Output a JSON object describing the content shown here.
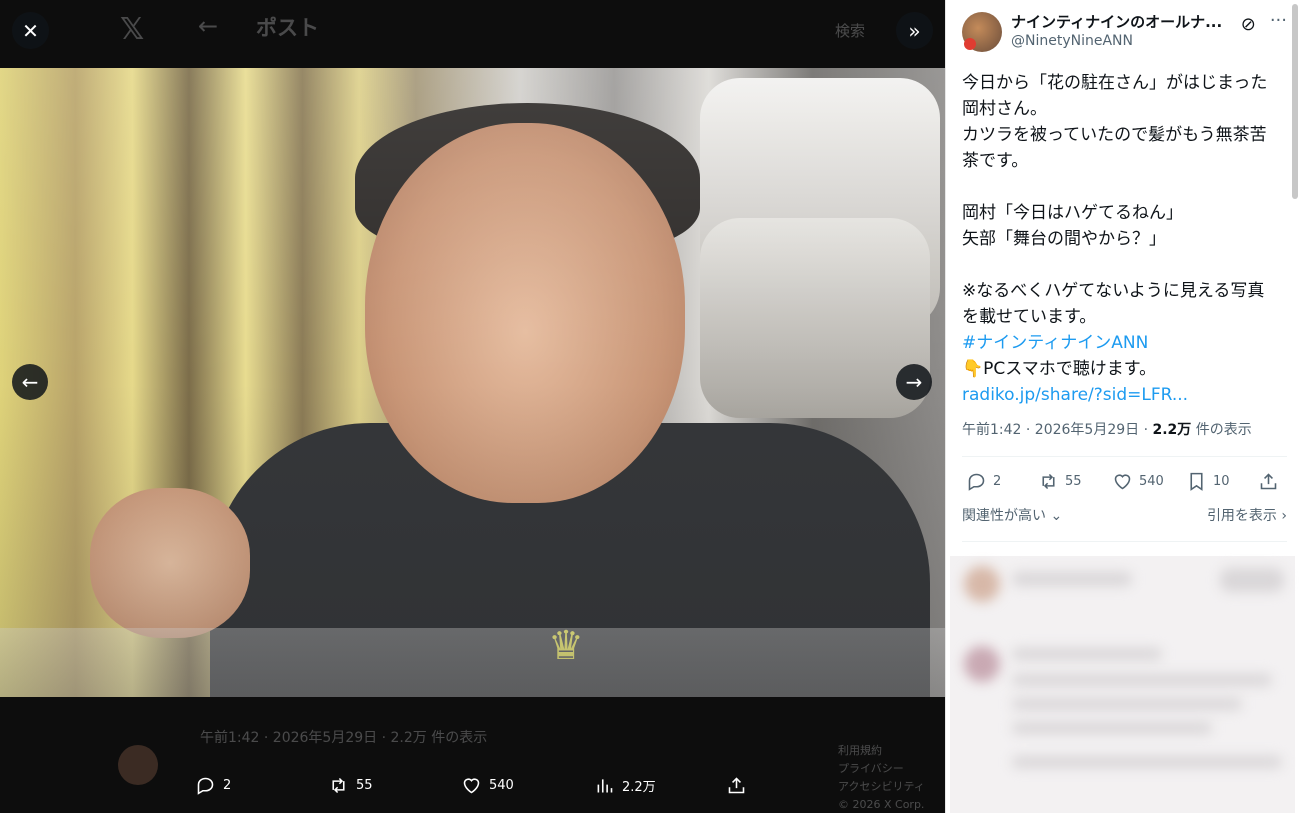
{
  "viewer": {
    "bg_title": "ポスト",
    "bg_search": "検索",
    "bg_meta": "午前1:42 · 2026年5月29日 · 2.2万 件の表示",
    "bg_side": [
      "利用規約",
      "プライバシー",
      "アクセシビリティ",
      "© 2026 X Corp."
    ],
    "actions": {
      "replies": "2",
      "reposts": "55",
      "likes": "540",
      "views": "2.2万"
    }
  },
  "tweet": {
    "author_name": "ナインティナインのオールナ...",
    "author_handle": "@NinetyNineANN",
    "body": [
      {
        "text": "今日から「花の駐在さん」がはじまった",
        "link": false
      },
      {
        "text": "岡村さん。",
        "link": false
      },
      {
        "text": "カツラを被っていたので髪がもう無茶苦",
        "link": false
      },
      {
        "text": "茶です。",
        "link": false
      },
      {
        "text": "",
        "link": false
      },
      {
        "text": "岡村「今日はハゲてるねん」",
        "link": false
      },
      {
        "text": "矢部「舞台の間やから？」",
        "link": false
      },
      {
        "text": "",
        "link": false
      },
      {
        "text": "※なるべくハゲてないように見える写真",
        "link": false
      },
      {
        "text": "を載せています。",
        "link": false
      },
      {
        "text": "#ナインティナインANN",
        "link": true
      },
      {
        "text": "👇PCスマホで聴けます。",
        "link": false
      },
      {
        "text": "radiko.jp/share/?sid=LFR...",
        "link": true
      }
    ],
    "timestamp_prefix": "午前1:42 · 2026年5月29日 · ",
    "views_count": "2.2万",
    "views_suffix": " 件の表示",
    "actions": {
      "replies": "2",
      "reposts": "55",
      "likes": "540",
      "bookmarks": "10"
    },
    "related_label": "関連性が高い ⌄",
    "quotes_label": "引用を表示 ›"
  },
  "colors": {
    "link": "#1d9bf0",
    "secondary_text": "#536471",
    "viewer_bg": "#0d0d0d"
  },
  "icons": [
    "close-icon",
    "x-logo-icon",
    "back-arrow-icon",
    "expand-icon",
    "prev-arrow-icon",
    "next-arrow-icon",
    "reply-icon",
    "repost-icon",
    "like-icon",
    "views-icon",
    "bookmark-icon",
    "share-icon",
    "grok-icon",
    "more-icon"
  ]
}
